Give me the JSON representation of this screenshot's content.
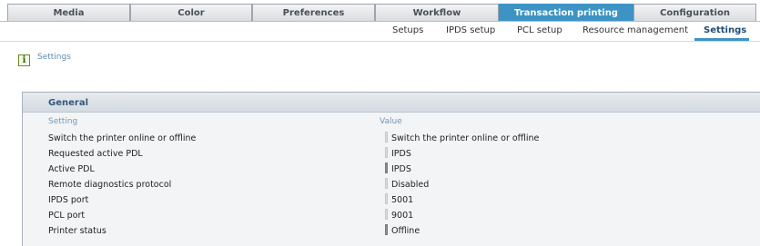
{
  "main_tabs": [
    {
      "label": "Media",
      "active": false
    },
    {
      "label": "Color",
      "active": false
    },
    {
      "label": "Preferences",
      "active": false
    },
    {
      "label": "Workflow",
      "active": false
    },
    {
      "label": "Transaction printing",
      "active": true
    },
    {
      "label": "Configuration",
      "active": false
    }
  ],
  "sub_tabs": [
    {
      "label": "Setups",
      "active": false
    },
    {
      "label": "IPDS setup",
      "active": false
    },
    {
      "label": "PCL setup",
      "active": false
    },
    {
      "label": "Resource management",
      "active": false
    },
    {
      "label": "Settings",
      "active": true
    }
  ],
  "page": {
    "icon": "info-icon",
    "icon_glyph": "i",
    "title": "Settings"
  },
  "panel": {
    "title": "General",
    "col_setting": "Setting",
    "col_value": "Value",
    "rows": [
      {
        "setting": "Switch the printer online or offline",
        "value": "Switch the printer online or offline"
      },
      {
        "setting": "Requested active PDL",
        "value": "IPDS"
      },
      {
        "setting": "Active PDL",
        "value": "IPDS"
      },
      {
        "setting": "Remote diagnostics protocol",
        "value": "Disabled"
      },
      {
        "setting": "IPDS port",
        "value": "5001"
      },
      {
        "setting": "PCL port",
        "value": "9001"
      },
      {
        "setting": "Printer status",
        "value": "Offline"
      }
    ]
  },
  "colors": {
    "accent": "#3c93c4",
    "title_blue": "#33577d",
    "icon_green": "#6c8a22"
  }
}
